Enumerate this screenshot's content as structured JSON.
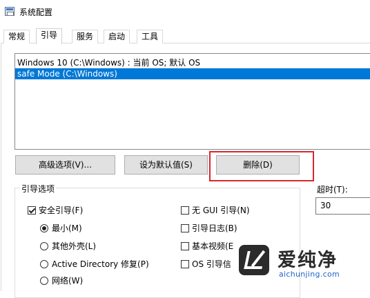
{
  "window": {
    "title": "系统配置"
  },
  "tabs": [
    {
      "label": "常规",
      "active": false
    },
    {
      "label": "引导",
      "active": true
    },
    {
      "label": "服务",
      "active": false
    },
    {
      "label": "启动",
      "active": false
    },
    {
      "label": "工具",
      "active": false
    }
  ],
  "os_list": {
    "items": [
      {
        "label": "Windows 10 (C:\\Windows) : 当前 OS; 默认 OS",
        "selected": false
      },
      {
        "label": "safe Mode (C:\\Windows)",
        "selected": true
      }
    ]
  },
  "buttons": {
    "advanced": "高级选项(V)...",
    "set_default": "设为默认值(S)",
    "delete": "删除(D)"
  },
  "boot_options": {
    "title": "引导选项",
    "safe_boot": {
      "label": "安全引导(F)",
      "checked": true
    },
    "minimal": {
      "label": "最小(M)",
      "selected": true
    },
    "alternate_shell": {
      "label": "其他外壳(L)",
      "selected": false
    },
    "active_directory": {
      "label": "Active Directory 修复(P)",
      "selected": false
    },
    "network": {
      "label": "网络(W)",
      "selected": false
    },
    "no_gui": {
      "label": "无 GUI 引导(N)",
      "checked": false
    },
    "boot_log": {
      "label": "引导日志(B)",
      "checked": false
    },
    "base_video": {
      "label": "基本视频(E",
      "checked": false
    },
    "os_boot_info": {
      "label": "OS 引导信",
      "checked": false
    }
  },
  "timeout": {
    "label": "超时(T):",
    "value": "30"
  },
  "watermark": {
    "brand": "爱纯净",
    "url": "aichunjing.com"
  },
  "colors": {
    "selection": "#0078d7",
    "highlight_box": "#d9262c",
    "watermark_url": "#1f63c6"
  }
}
